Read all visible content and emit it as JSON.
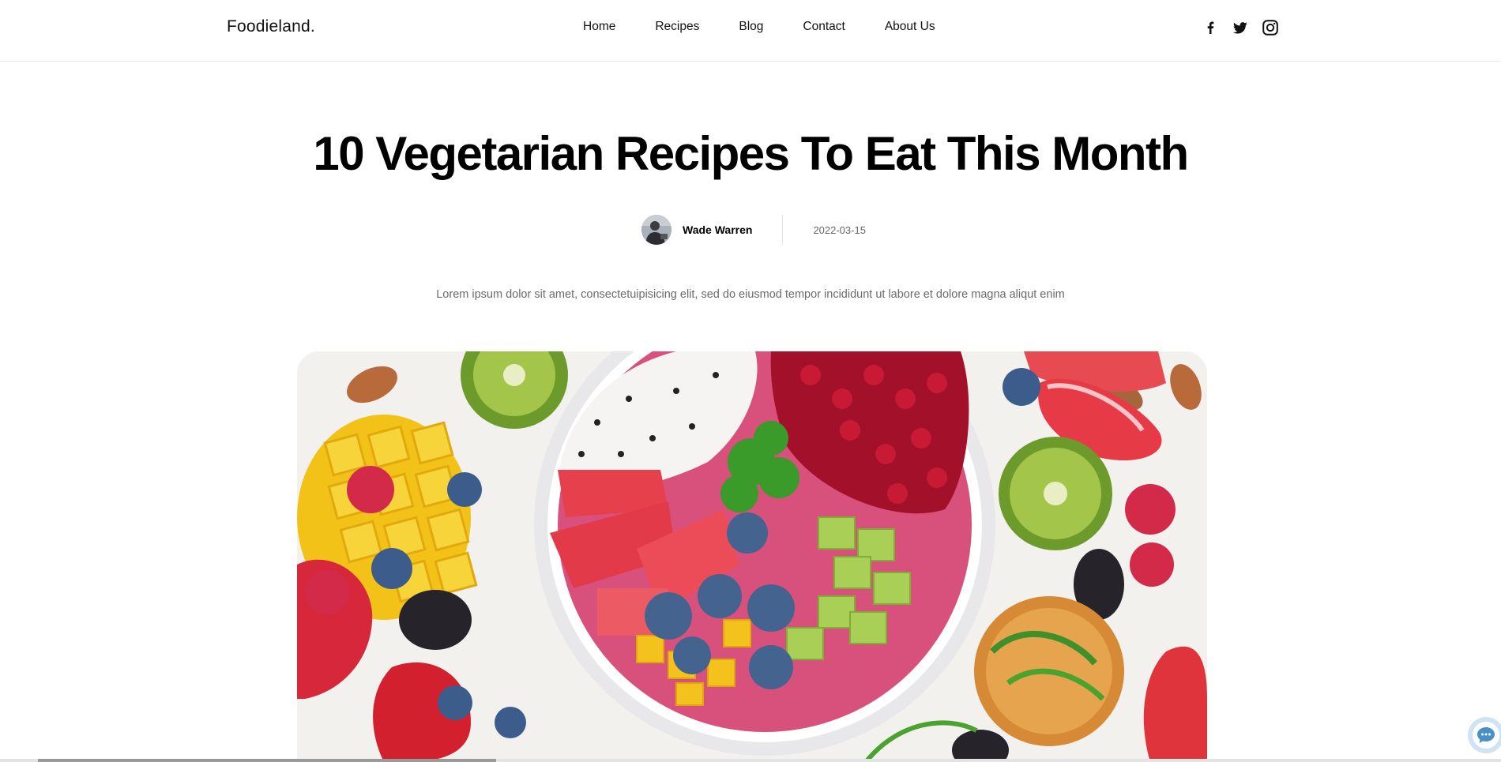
{
  "header": {
    "logo": "Foodieland.",
    "nav": [
      "Home",
      "Recipes",
      "Blog",
      "Contact",
      "About Us"
    ],
    "social": [
      "facebook-icon",
      "twitter-icon",
      "instagram-icon"
    ]
  },
  "article": {
    "title": "10 Vegetarian Recipes To Eat This Month",
    "author": "Wade Warren",
    "date": "2022-03-15",
    "description": "Lorem ipsum dolor sit amet, consectetuipisicing elit, sed do eiusmod tempor incididunt ut labore et dolore magna aliqut enim"
  },
  "widgets": {
    "chat_icon": "chat-bubble-icon"
  }
}
